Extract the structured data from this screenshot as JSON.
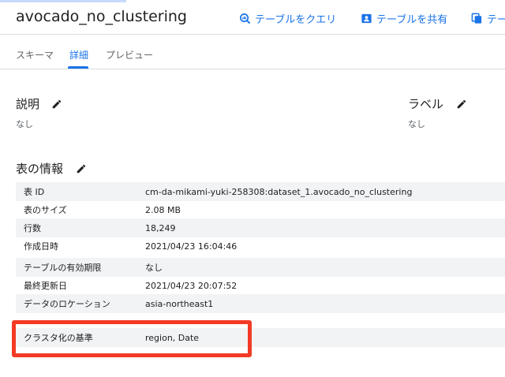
{
  "header": {
    "title": "avocado_no_clustering",
    "actions": [
      {
        "label": "テーブルをクエリ",
        "icon": "query-icon"
      },
      {
        "label": "テーブルを共有",
        "icon": "share-icon"
      },
      {
        "label": "テー",
        "icon": "copy-icon"
      }
    ]
  },
  "tabs": [
    {
      "label": "スキーマ",
      "active": false
    },
    {
      "label": "詳細",
      "active": true
    },
    {
      "label": "プレビュー",
      "active": false
    }
  ],
  "description": {
    "heading": "説明",
    "value": "なし"
  },
  "labels": {
    "heading": "ラベル",
    "value": "なし"
  },
  "table_info": {
    "heading": "表の情報",
    "rows": [
      {
        "key": "表 ID",
        "value": "cm-da-mikami-yuki-258308:dataset_1.avocado_no_clustering"
      },
      {
        "key": "表のサイズ",
        "value": "2.08 MB"
      },
      {
        "key": "行数",
        "value": "18,249"
      },
      {
        "key": "作成日時",
        "value": "2021/04/23 16:04:46"
      },
      {
        "key": "テーブルの有効期限",
        "value": "なし"
      },
      {
        "key": "最終更新日",
        "value": "2021/04/23 20:07:52"
      },
      {
        "key": "データのロケーション",
        "value": "asia-northeast1"
      },
      {
        "key": "クラスタ化の基準",
        "value": "region, Date"
      }
    ]
  },
  "colors": {
    "accent": "#1a73e8",
    "highlight": "#f23a25",
    "row_shade": "#f1f3f4"
  }
}
